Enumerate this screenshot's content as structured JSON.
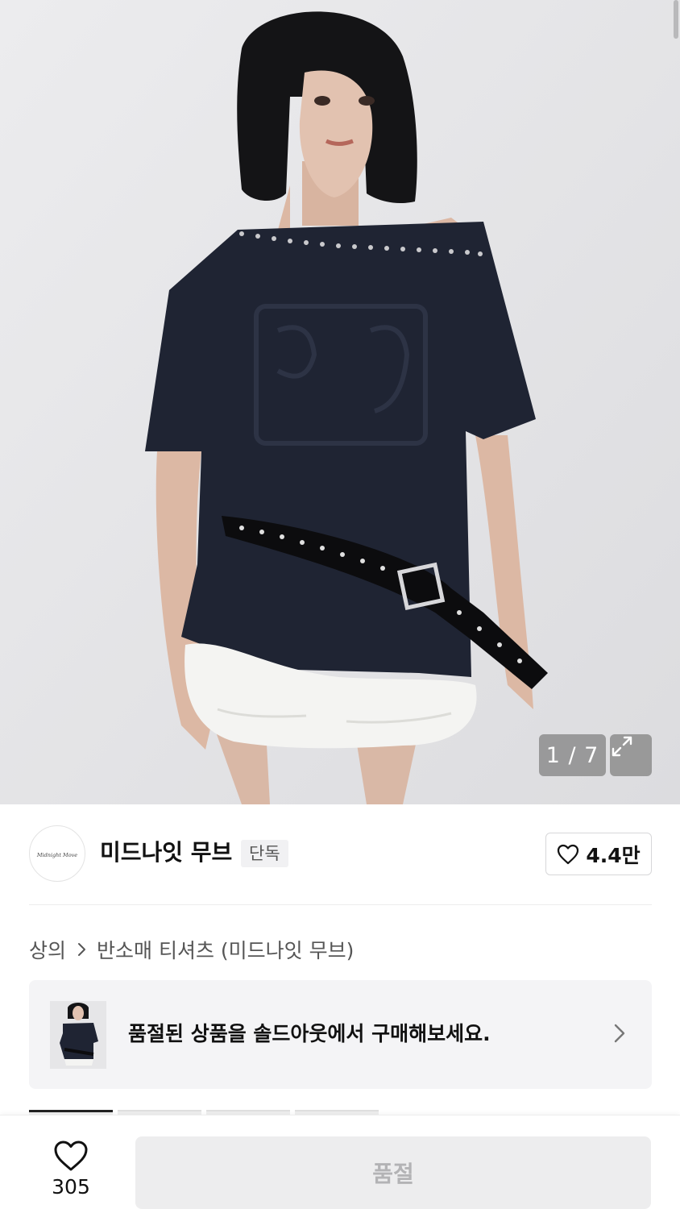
{
  "gallery": {
    "counter": "1 / 7",
    "expand_icon": "expand-icon"
  },
  "brand": {
    "logo_text": "Midnight Move",
    "name": "미드나잇 무브",
    "badge": "단독",
    "like_count": "4.4만"
  },
  "breadcrumb": {
    "category": "상의",
    "subcategory": "반소매 티셔츠 (미드나잇 무브)"
  },
  "soldout_banner": {
    "text": "품절된 상품을 솔드아웃에서 구매해보세요."
  },
  "bottom_bar": {
    "wish_count": "305",
    "buy_label": "품절"
  },
  "colors": {
    "accent_dark": "#111111",
    "disabled_bg": "#ededee",
    "disabled_text": "#b3b3b5",
    "shirt_navy": "#1f2433"
  }
}
